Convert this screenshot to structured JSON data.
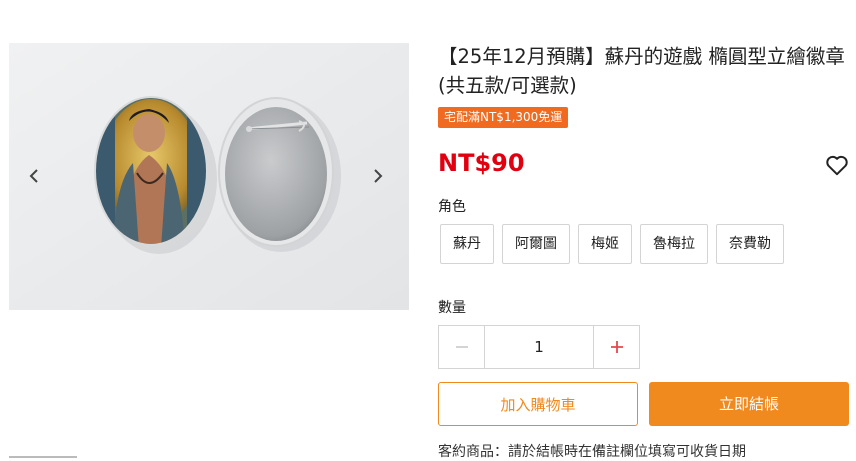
{
  "product": {
    "title": "【25年12月預購】蘇丹的遊戲 橢圓型立繪徽章 (共五款/可選款)",
    "promo_badge": "宅配滿NT$1,300免運",
    "price": "NT$90"
  },
  "gallery": {
    "prev_icon": "chevron-left-icon",
    "next_icon": "chevron-right-icon"
  },
  "options": {
    "label": "角色",
    "variants": [
      "蘇丹",
      "阿爾圖",
      "梅姬",
      "魯梅拉",
      "奈費勒"
    ]
  },
  "quantity": {
    "label": "數量",
    "value": "1",
    "minus_icon": "minus-icon",
    "plus_icon": "plus-icon"
  },
  "actions": {
    "add_to_cart": "加入購物車",
    "checkout": "立即結帳"
  },
  "note": "客約商品：請於結帳時在備註欄位填寫可收貨日期",
  "colors": {
    "price": "#e0000f",
    "accent": "#f08a1e",
    "badge": "#f06b1f"
  }
}
